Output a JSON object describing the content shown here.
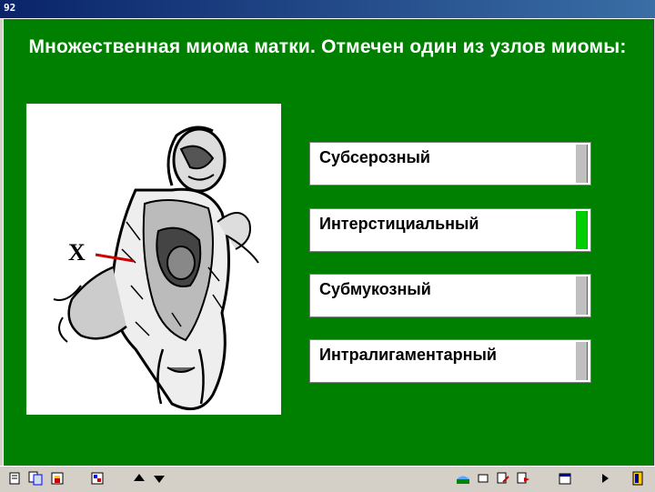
{
  "window": {
    "title": "92"
  },
  "question": "Множественная миома матки. Отмечен один из узлов миомы:",
  "figure": {
    "marker": "X"
  },
  "answers": [
    {
      "label": "Субсерозный",
      "state": "neutral"
    },
    {
      "label": "Интерстициальный",
      "state": "correct"
    },
    {
      "label": "Субмукозный",
      "state": "neutral"
    },
    {
      "label": "Интралигаментарный",
      "state": "neutral"
    }
  ],
  "colors": {
    "background": "#008000",
    "correct": "#00d000",
    "pointer": "#cc0000"
  },
  "toolbar": {
    "icons": [
      "notes-icon",
      "copy-icon",
      "print-icon",
      "palette-icon",
      "arrow-up-icon",
      "arrow-down-icon",
      "chart-icon",
      "rect-icon",
      "edit-icon",
      "flag-icon",
      "calendar-icon",
      "play-icon",
      "exit-icon"
    ]
  }
}
